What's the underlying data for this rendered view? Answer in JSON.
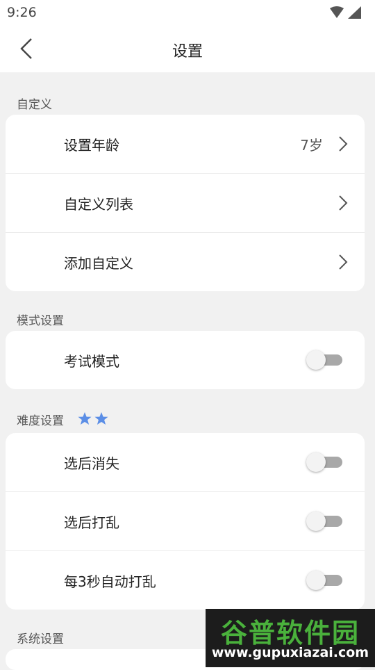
{
  "status": {
    "time": "9:26"
  },
  "header": {
    "title": "设置",
    "back_icon": "chevron-left-icon"
  },
  "sections": [
    {
      "title": "自定义",
      "rows": [
        {
          "label": "设置年龄",
          "value": "7岁"
        },
        {
          "label": "自定义列表"
        },
        {
          "label": "添加自定义"
        }
      ]
    },
    {
      "title": "模式设置",
      "rows": [
        {
          "label": "考试模式",
          "toggle": false
        }
      ]
    },
    {
      "title": "难度设置",
      "stars": 2,
      "star_color": "#5b8ee6",
      "rows": [
        {
          "label": "选后消失",
          "toggle": false
        },
        {
          "label": "选后打乱",
          "toggle": false
        },
        {
          "label": "每3秒自动打乱",
          "toggle": false
        }
      ]
    },
    {
      "title": "系统设置"
    }
  ],
  "watermark": {
    "title": "谷普软件园",
    "url": "www.gupuxiazai.com"
  }
}
